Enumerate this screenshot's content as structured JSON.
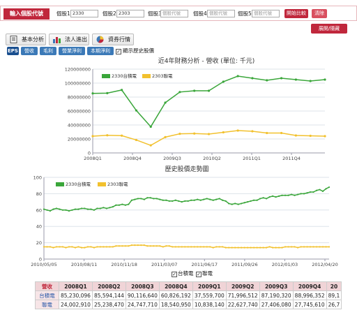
{
  "toolbar": {
    "header_label": "輸入個股代號",
    "stocks": [
      {
        "label": "個股1",
        "value": "2330",
        "placeholder": ""
      },
      {
        "label": "個股2",
        "value": "2303",
        "placeholder": ""
      },
      {
        "label": "個股3",
        "value": "",
        "placeholder": "個股代號"
      },
      {
        "label": "個股4",
        "value": "",
        "placeholder": "個股代號"
      },
      {
        "label": "個股5",
        "value": "",
        "placeholder": "個股代號"
      }
    ],
    "compare_label": "開始比較",
    "clear_label": "清除"
  },
  "expand_label": "展開/隱藏",
  "tabs": [
    {
      "label": "基本分析",
      "icon": "document-icon"
    },
    {
      "label": "法人進出",
      "icon": "bar-chart-icon"
    },
    {
      "label": "資券行情",
      "icon": "pie-chart-icon"
    }
  ],
  "metric_tabs": [
    "EPS",
    "營收",
    "毛利",
    "營業淨利",
    "本期淨利"
  ],
  "history_checkbox_label": "顯示歷史股價",
  "colors": {
    "accent": "#c0273c",
    "green": "#3aa63a",
    "yellow": "#f2c12e",
    "blue": "#3b79b7"
  },
  "chart_data": [
    {
      "type": "line",
      "title": "近4年財務分析 - 營收 (單位: 千元)",
      "x_tick_labels": [
        "2008Q1",
        "2008Q4",
        "2009Q3",
        "2010Q2",
        "2011Q1",
        "2011Q4"
      ],
      "yticks": [
        "0",
        "20000000",
        "40000000",
        "60000000",
        "80000000",
        "100000000",
        "120000000"
      ],
      "ylim": [
        0,
        120000000
      ],
      "x": [
        "2008Q1",
        "2008Q2",
        "2008Q3",
        "2008Q4",
        "2009Q1",
        "2009Q2",
        "2009Q3",
        "2009Q4",
        "2010Q1",
        "2010Q2",
        "2010Q3",
        "2010Q4",
        "2011Q1",
        "2011Q2",
        "2011Q3",
        "2011Q4",
        "2012Q1"
      ],
      "series": [
        {
          "name": "2330台積電",
          "color": "#3aa63a",
          "values": [
            85230096,
            85594144,
            90116640,
            60826192,
            37559700,
            71996512,
            87190320,
            88996352,
            89000000,
            102000000,
            110000000,
            107000000,
            104000000,
            107000000,
            105000000,
            103000000,
            105000000
          ]
        },
        {
          "name": "2303聯電",
          "color": "#f2c12e",
          "values": [
            24002910,
            25238470,
            24747710,
            18540950,
            10838140,
            22627740,
            27406080,
            27745610,
            27000000,
            29500000,
            32000000,
            31000000,
            28500000,
            28500000,
            25000000,
            24500000,
            24000000
          ]
        }
      ],
      "legend": "top-left"
    },
    {
      "type": "line",
      "title": "歷史股價走勢圖",
      "x_tick_labels": [
        "2010/05/05",
        "2010/08/11",
        "2010/11/18",
        "2011/03/07",
        "2011/06/17",
        "2011/09/26",
        "2012/01/03",
        "2012/04/20"
      ],
      "yticks": [
        "0",
        "20",
        "40",
        "60",
        "80",
        "100"
      ],
      "ylim": [
        0,
        100
      ],
      "series": [
        {
          "name": "2330台積電",
          "color": "#3aa63a",
          "values": [
            61,
            60,
            59,
            61,
            62,
            61,
            60,
            60,
            59,
            60,
            61,
            61,
            62,
            62,
            61,
            61,
            60,
            62,
            62,
            63,
            62,
            63,
            64,
            66,
            66,
            67,
            66,
            67,
            72,
            73,
            74,
            74,
            73,
            75,
            75,
            74,
            74,
            73,
            72,
            72,
            71,
            71,
            72,
            71,
            70,
            71,
            71,
            72,
            72,
            73,
            72,
            73,
            74,
            73,
            72,
            73,
            74,
            72,
            71,
            68,
            67,
            68,
            67,
            68,
            69,
            70,
            71,
            72,
            72,
            74,
            75,
            74,
            76,
            77,
            76,
            77,
            78,
            78,
            78,
            79,
            78,
            79,
            80,
            80,
            81,
            82,
            82,
            84,
            85,
            83,
            86,
            88
          ]
        },
        {
          "name": "2303聯電",
          "color": "#f2c12e",
          "values": [
            15,
            15,
            15,
            14,
            15,
            15,
            15,
            14,
            15,
            15,
            14,
            15,
            14,
            14,
            15,
            15,
            14,
            15,
            15,
            15,
            15,
            15,
            15,
            16,
            16,
            16,
            16,
            16,
            17,
            17,
            17,
            17,
            17,
            16,
            16,
            16,
            16,
            16,
            15,
            16,
            16,
            15,
            15,
            15,
            15,
            15,
            15,
            15,
            15,
            15,
            15,
            15,
            15,
            15,
            14,
            15,
            15,
            15,
            14,
            14,
            14,
            14,
            14,
            14,
            14,
            14,
            14,
            14,
            14,
            14,
            14,
            14,
            15,
            14,
            14,
            14,
            14,
            15,
            15,
            15,
            15,
            14,
            15,
            15,
            15,
            15,
            15,
            15,
            15,
            15,
            15,
            15
          ]
        }
      ],
      "checkbox_legend": [
        "台積電",
        "聯電"
      ],
      "legend": "top-left"
    }
  ],
  "table": {
    "corner": "營收",
    "columns": [
      "2008Q1",
      "2008Q2",
      "2008Q3",
      "2008Q4",
      "2009Q1",
      "2009Q2",
      "2009Q3",
      "2009Q4",
      "20"
    ],
    "rows": [
      {
        "name": "台積電",
        "values": [
          "85,230,096",
          "85,594,144",
          "90,116,640",
          "60,826,192",
          "37,559,700",
          "71,996,512",
          "87,190,320",
          "88,996,352",
          "89,1"
        ]
      },
      {
        "name": "聯電",
        "values": [
          "24,002,910",
          "25,238,470",
          "24,747,710",
          "18,540,950",
          "10,838,140",
          "22,627,740",
          "27,406,080",
          "27,745,610",
          "26,7"
        ]
      }
    ]
  }
}
